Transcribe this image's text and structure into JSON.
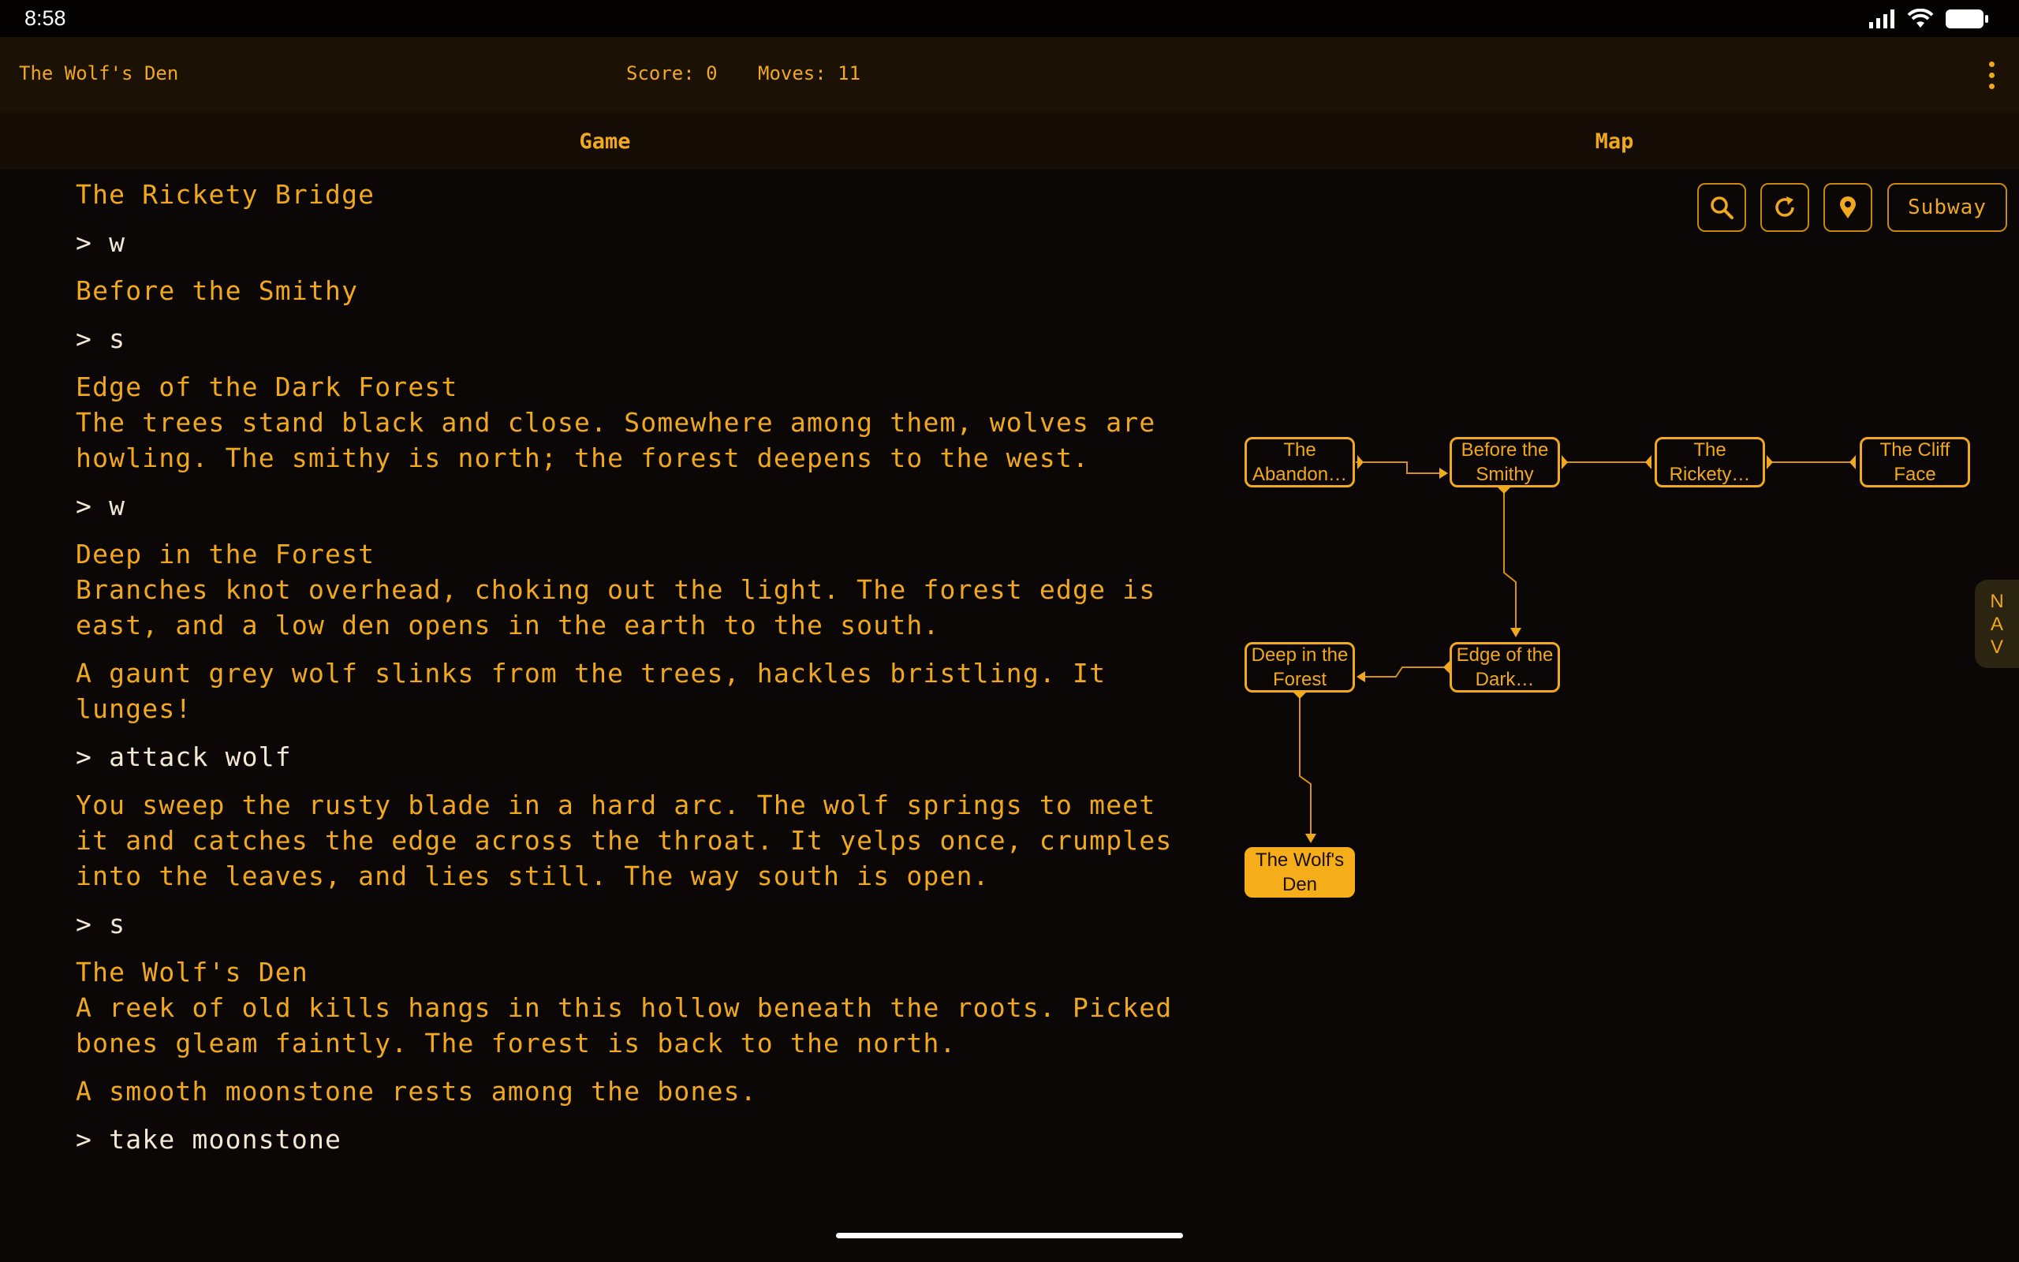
{
  "status_bar": {
    "time": "8:58"
  },
  "top_bar": {
    "title": "The Wolf's Den",
    "score": "Score: 0",
    "moves": "Moves: 11"
  },
  "tabs": [
    {
      "label": "Game"
    },
    {
      "label": "Map"
    }
  ],
  "transcript": [
    {
      "kind": "room",
      "text": "The Rickety Bridge"
    },
    {
      "kind": "cmd",
      "text": "> w"
    },
    {
      "kind": "room",
      "text": "Before the Smithy"
    },
    {
      "kind": "cmd",
      "text": "> s"
    },
    {
      "kind": "room",
      "text": "Edge of the Dark Forest\nThe trees stand black and close. Somewhere among them, wolves are\nhowling. The smithy is north; the forest deepens to the west."
    },
    {
      "kind": "cmd",
      "text": "> w"
    },
    {
      "kind": "room",
      "text": "Deep in the Forest\nBranches knot overhead, choking out the light. The forest edge is\neast, and a low den opens in the earth to the south."
    },
    {
      "kind": "text",
      "text": "A gaunt grey wolf slinks from the trees, hackles bristling. It\nlunges!"
    },
    {
      "kind": "cmd",
      "text": "> attack wolf"
    },
    {
      "kind": "text",
      "text": "You sweep the rusty blade in a hard arc. The wolf springs to meet\nit and catches the edge across the throat. It yelps once, crumples\ninto the leaves, and lies still. The way south is open."
    },
    {
      "kind": "cmd",
      "text": "> s"
    },
    {
      "kind": "room",
      "text": "The Wolf's Den\nA reek of old kills hangs in this hollow beneath the roots. Picked\nbones gleam faintly. The forest is back to the north."
    },
    {
      "kind": "text",
      "text": "A smooth moonstone rests among the bones."
    },
    {
      "kind": "cmd",
      "text": "> take moonstone"
    }
  ],
  "map": {
    "tools": {
      "search_icon": "search-icon",
      "refresh_icon": "refresh-icon",
      "locate_icon": "location-pin-icon",
      "subway_label": "Subway"
    },
    "nodes": [
      {
        "id": "abandoned",
        "label": "The Abandon…",
        "current": false
      },
      {
        "id": "smithy",
        "label": "Before the Smithy",
        "current": false
      },
      {
        "id": "bridge",
        "label": "The Rickety…",
        "current": false
      },
      {
        "id": "cliff",
        "label": "The Cliff Face",
        "current": false
      },
      {
        "id": "deep",
        "label": "Deep in the Forest",
        "current": false
      },
      {
        "id": "edge",
        "label": "Edge of the Dark…",
        "current": false
      },
      {
        "id": "den",
        "label": "The Wolf's Den",
        "current": true
      }
    ],
    "nav_label": [
      "N",
      "A",
      "V"
    ]
  },
  "colors": {
    "accent": "#f0a81f",
    "background": "#0b0706",
    "header": "#1c1105",
    "command_text": "#f3e8d6"
  }
}
